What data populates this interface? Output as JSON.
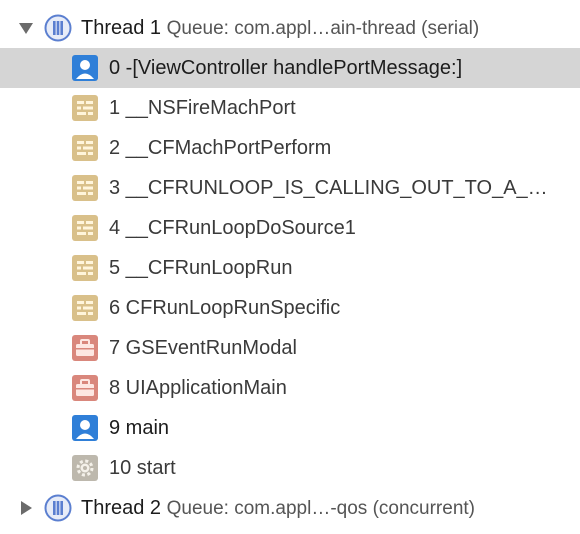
{
  "colors": {
    "selection": "#d5d5d5",
    "thread_icon": "#5b7fd0",
    "user_frame_icon": "#2f7fd8",
    "library_frame_icon": "#d9c08a",
    "uikit_frame_icon": "#d9877c",
    "start_frame_icon": "#bdb8ad"
  },
  "threads": [
    {
      "expanded": true,
      "disclosure_icon": "triangle-down",
      "icon": "thread-icon",
      "title": "Thread 1",
      "queue": "Queue: com.appl…ain-thread (serial)",
      "frames": [
        {
          "label": "0 -[ViewController handlePortMessage:]",
          "icon": "user-code-icon",
          "selected": true
        },
        {
          "label": "1 __NSFireMachPort",
          "icon": "library-frame-icon"
        },
        {
          "label": "2 __CFMachPortPerform",
          "icon": "library-frame-icon"
        },
        {
          "label": "3 __CFRUNLOOP_IS_CALLING_OUT_TO_A_…",
          "icon": "library-frame-icon"
        },
        {
          "label": "4 __CFRunLoopDoSource1",
          "icon": "library-frame-icon"
        },
        {
          "label": "5 __CFRunLoopRun",
          "icon": "library-frame-icon"
        },
        {
          "label": "6 CFRunLoopRunSpecific",
          "icon": "library-frame-icon"
        },
        {
          "label": "7 GSEventRunModal",
          "icon": "briefcase-frame-icon"
        },
        {
          "label": "8 UIApplicationMain",
          "icon": "briefcase-frame-icon"
        },
        {
          "label": "9 main",
          "icon": "user-code-icon"
        },
        {
          "label": "10 start",
          "icon": "gear-frame-icon"
        }
      ]
    },
    {
      "expanded": false,
      "disclosure_icon": "triangle-right",
      "icon": "thread-icon",
      "title": "Thread 2",
      "queue": "Queue: com.appl…-qos (concurrent)",
      "frames": []
    }
  ]
}
